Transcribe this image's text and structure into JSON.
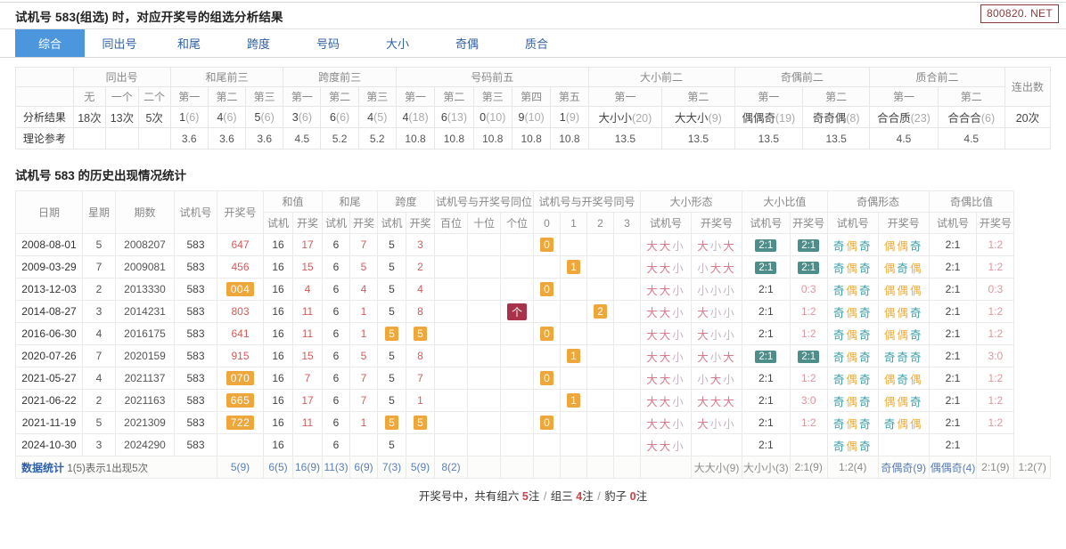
{
  "header": {
    "title": "试机号 583(组选) 时，对应开奖号的组选分析结果",
    "site_badge": "800820. NET"
  },
  "tabs": [
    {
      "label": "综合",
      "active": true
    },
    {
      "label": "同出号",
      "active": false
    },
    {
      "label": "和尾",
      "active": false
    },
    {
      "label": "跨度",
      "active": false
    },
    {
      "label": "号码",
      "active": false
    },
    {
      "label": "大小",
      "active": false
    },
    {
      "label": "奇偶",
      "active": false
    },
    {
      "label": "质合",
      "active": false
    }
  ],
  "analysis": {
    "group_headers": [
      {
        "label": "",
        "span": 1
      },
      {
        "label": "同出号",
        "span": 3
      },
      {
        "label": "和尾前三",
        "span": 3
      },
      {
        "label": "跨度前三",
        "span": 3
      },
      {
        "label": "号码前五",
        "span": 5
      },
      {
        "label": "大小前二",
        "span": 2
      },
      {
        "label": "奇偶前二",
        "span": 2
      },
      {
        "label": "质合前二",
        "span": 2
      },
      {
        "label": "连出数",
        "span": 1,
        "rowspan": 2
      }
    ],
    "sub_headers": [
      "无",
      "一个",
      "二个",
      "第一",
      "第二",
      "第三",
      "第一",
      "第二",
      "第三",
      "第一",
      "第二",
      "第三",
      "第四",
      "第五",
      "第一",
      "第二",
      "第一",
      "第二",
      "第一",
      "第二"
    ],
    "row_label_result": "分析结果",
    "row_label_theory": "理论参考",
    "results": [
      {
        "main": "18次",
        "paren": ""
      },
      {
        "main": "13次",
        "paren": ""
      },
      {
        "main": "5次",
        "paren": ""
      },
      {
        "main": "1",
        "paren": "(6)"
      },
      {
        "main": "4",
        "paren": "(6)"
      },
      {
        "main": "5",
        "paren": "(6)"
      },
      {
        "main": "3",
        "paren": "(6)"
      },
      {
        "main": "6",
        "paren": "(6)"
      },
      {
        "main": "4",
        "paren": "(5)"
      },
      {
        "main": "4",
        "paren": "(18)"
      },
      {
        "main": "6",
        "paren": "(13)"
      },
      {
        "main": "0",
        "paren": "(10)"
      },
      {
        "main": "9",
        "paren": "(10)"
      },
      {
        "main": "1",
        "paren": "(9)"
      },
      {
        "main": "大小小",
        "paren": "(20)"
      },
      {
        "main": "大大小",
        "paren": "(9)"
      },
      {
        "main": "偶偶奇",
        "paren": "(19)"
      },
      {
        "main": "奇奇偶",
        "paren": "(8)"
      },
      {
        "main": "合合质",
        "paren": "(23)"
      },
      {
        "main": "合合合",
        "paren": "(6)"
      }
    ],
    "lianchushu": "20次",
    "theory": [
      "",
      "",
      "",
      "3.6",
      "3.6",
      "3.6",
      "4.5",
      "5.2",
      "5.2",
      "10.8",
      "10.8",
      "10.8",
      "10.8",
      "10.8",
      "13.5",
      "13.5",
      "13.5",
      "13.5",
      "4.5",
      "4.5"
    ]
  },
  "history_section": {
    "heading": "试机号 583 的历史出现情况统计",
    "columns": {
      "date": "日期",
      "week": "星期",
      "issue": "期数",
      "shijihao": "试机号",
      "kaijianghao": "开奖号",
      "hezhi": "和值",
      "hewei": "和尾",
      "kuadu": "跨度",
      "tongwei": "试机号与开奖号同位",
      "tonghao": "试机号与开奖号同号",
      "daxiao_xingtai": "大小形态",
      "daxiao_bizhi": "大小比值",
      "jiou_xingtai": "奇偶形态",
      "jiou_bizhi": "奇偶比值",
      "sub_shiji": "试机",
      "sub_kaijiang": "开奖",
      "sub_baiwei": "百位",
      "sub_shiwei": "十位",
      "sub_gewei": "个位",
      "sub_0": "0",
      "sub_1": "1",
      "sub_2": "2",
      "sub_3": "3",
      "sub_shijihao": "试机号",
      "sub_kaijianghao": "开奖号"
    },
    "rows": [
      {
        "date": "2008-08-01",
        "week": "5",
        "issue": "2008207",
        "shijihao": "583",
        "kaijianghao": "647",
        "kj_hl": false,
        "hezhi_shiji": "16",
        "hezhi_kaijiang": "17",
        "hewei_shiji": "6",
        "hewei_kaijiang": "7",
        "kuadu_shiji": "5",
        "kuadu_shiji_hl": false,
        "kuadu_kaijiang": "3",
        "kuadu_kaijiang_hl": false,
        "tongwei": {
          "baiwei": "",
          "shiwei": "",
          "gewei": ""
        },
        "tonghao": {
          "v0": "0",
          "v1": "",
          "v2": "",
          "v3": ""
        },
        "dx_shiji": "大大小",
        "dx_kaijiang": "大小大",
        "dxb_shiji": "2:1",
        "dxb_shiji_hl": true,
        "dxb_kaijiang": "2:1",
        "dxb_kaijiang_hl": true,
        "jo_shiji": "奇偶奇",
        "jo_kaijiang": "偶偶奇",
        "job_shiji": "2:1",
        "job_kaijiang": "1:2"
      },
      {
        "date": "2009-03-29",
        "week": "7",
        "issue": "2009081",
        "shijihao": "583",
        "kaijianghao": "456",
        "kj_hl": false,
        "hezhi_shiji": "16",
        "hezhi_kaijiang": "15",
        "hewei_shiji": "6",
        "hewei_kaijiang": "5",
        "kuadu_shiji": "5",
        "kuadu_shiji_hl": false,
        "kuadu_kaijiang": "2",
        "kuadu_kaijiang_hl": false,
        "tongwei": {
          "baiwei": "",
          "shiwei": "",
          "gewei": ""
        },
        "tonghao": {
          "v0": "",
          "v1": "1",
          "v2": "",
          "v3": ""
        },
        "dx_shiji": "大大小",
        "dx_kaijiang": "小大大",
        "dxb_shiji": "2:1",
        "dxb_shiji_hl": true,
        "dxb_kaijiang": "2:1",
        "dxb_kaijiang_hl": true,
        "jo_shiji": "奇偶奇",
        "jo_kaijiang": "偶奇偶",
        "job_shiji": "2:1",
        "job_kaijiang": "1:2"
      },
      {
        "date": "2013-12-03",
        "week": "2",
        "issue": "2013330",
        "shijihao": "583",
        "kaijianghao": "004",
        "kj_hl": true,
        "hezhi_shiji": "16",
        "hezhi_kaijiang": "4",
        "hewei_shiji": "6",
        "hewei_kaijiang": "4",
        "kuadu_shiji": "5",
        "kuadu_shiji_hl": false,
        "kuadu_kaijiang": "4",
        "kuadu_kaijiang_hl": false,
        "tongwei": {
          "baiwei": "",
          "shiwei": "",
          "gewei": ""
        },
        "tonghao": {
          "v0": "0",
          "v1": "",
          "v2": "",
          "v3": ""
        },
        "dx_shiji": "大大小",
        "dx_kaijiang": "小小小",
        "dxb_shiji": "2:1",
        "dxb_shiji_hl": false,
        "dxb_kaijiang": "0:3",
        "dxb_kaijiang_hl": false,
        "jo_shiji": "奇偶奇",
        "jo_kaijiang": "偶偶偶",
        "job_shiji": "2:1",
        "job_kaijiang": "0:3"
      },
      {
        "date": "2014-08-27",
        "week": "3",
        "issue": "2014231",
        "shijihao": "583",
        "kaijianghao": "803",
        "kj_hl": false,
        "hezhi_shiji": "16",
        "hezhi_kaijiang": "11",
        "hewei_shiji": "6",
        "hewei_kaijiang": "1",
        "kuadu_shiji": "5",
        "kuadu_shiji_hl": false,
        "kuadu_kaijiang": "8",
        "kuadu_kaijiang_hl": false,
        "tongwei": {
          "baiwei": "",
          "shiwei": "",
          "gewei": "个"
        },
        "tonghao": {
          "v0": "",
          "v1": "",
          "v2": "2",
          "v3": ""
        },
        "dx_shiji": "大大小",
        "dx_kaijiang": "大小小",
        "dxb_shiji": "2:1",
        "dxb_shiji_hl": false,
        "dxb_kaijiang": "1:2",
        "dxb_kaijiang_hl": false,
        "jo_shiji": "奇偶奇",
        "jo_kaijiang": "偶偶奇",
        "job_shiji": "2:1",
        "job_kaijiang": "1:2"
      },
      {
        "date": "2016-06-30",
        "week": "4",
        "issue": "2016175",
        "shijihao": "583",
        "kaijianghao": "641",
        "kj_hl": false,
        "hezhi_shiji": "16",
        "hezhi_kaijiang": "11",
        "hewei_shiji": "6",
        "hewei_kaijiang": "1",
        "kuadu_shiji": "5",
        "kuadu_shiji_hl": true,
        "kuadu_kaijiang": "5",
        "kuadu_kaijiang_hl": true,
        "tongwei": {
          "baiwei": "",
          "shiwei": "",
          "gewei": ""
        },
        "tonghao": {
          "v0": "0",
          "v1": "",
          "v2": "",
          "v3": ""
        },
        "dx_shiji": "大大小",
        "dx_kaijiang": "大小小",
        "dxb_shiji": "2:1",
        "dxb_shiji_hl": false,
        "dxb_kaijiang": "1:2",
        "dxb_kaijiang_hl": false,
        "jo_shiji": "奇偶奇",
        "jo_kaijiang": "偶偶奇",
        "job_shiji": "2:1",
        "job_kaijiang": "1:2"
      },
      {
        "date": "2020-07-26",
        "week": "7",
        "issue": "2020159",
        "shijihao": "583",
        "kaijianghao": "915",
        "kj_hl": false,
        "hezhi_shiji": "16",
        "hezhi_kaijiang": "15",
        "hewei_shiji": "6",
        "hewei_kaijiang": "5",
        "kuadu_shiji": "5",
        "kuadu_shiji_hl": false,
        "kuadu_kaijiang": "8",
        "kuadu_kaijiang_hl": false,
        "tongwei": {
          "baiwei": "",
          "shiwei": "",
          "gewei": ""
        },
        "tonghao": {
          "v0": "",
          "v1": "1",
          "v2": "",
          "v3": ""
        },
        "dx_shiji": "大大小",
        "dx_kaijiang": "大小大",
        "dxb_shiji": "2:1",
        "dxb_shiji_hl": true,
        "dxb_kaijiang": "2:1",
        "dxb_kaijiang_hl": true,
        "jo_shiji": "奇偶奇",
        "jo_kaijiang": "奇奇奇",
        "job_shiji": "2:1",
        "job_kaijiang": "3:0"
      },
      {
        "date": "2021-05-27",
        "week": "4",
        "issue": "2021137",
        "shijihao": "583",
        "kaijianghao": "070",
        "kj_hl": true,
        "hezhi_shiji": "16",
        "hezhi_kaijiang": "7",
        "hewei_shiji": "6",
        "hewei_kaijiang": "7",
        "kuadu_shiji": "5",
        "kuadu_shiji_hl": false,
        "kuadu_kaijiang": "7",
        "kuadu_kaijiang_hl": false,
        "tongwei": {
          "baiwei": "",
          "shiwei": "",
          "gewei": ""
        },
        "tonghao": {
          "v0": "0",
          "v1": "",
          "v2": "",
          "v3": ""
        },
        "dx_shiji": "大大小",
        "dx_kaijiang": "小大小",
        "dxb_shiji": "2:1",
        "dxb_shiji_hl": false,
        "dxb_kaijiang": "1:2",
        "dxb_kaijiang_hl": false,
        "jo_shiji": "奇偶奇",
        "jo_kaijiang": "偶奇偶",
        "job_shiji": "2:1",
        "job_kaijiang": "1:2"
      },
      {
        "date": "2021-06-22",
        "week": "2",
        "issue": "2021163",
        "shijihao": "583",
        "kaijianghao": "665",
        "kj_hl": true,
        "hezhi_shiji": "16",
        "hezhi_kaijiang": "17",
        "hewei_shiji": "6",
        "hewei_kaijiang": "7",
        "kuadu_shiji": "5",
        "kuadu_shiji_hl": false,
        "kuadu_kaijiang": "1",
        "kuadu_kaijiang_hl": false,
        "tongwei": {
          "baiwei": "",
          "shiwei": "",
          "gewei": ""
        },
        "tonghao": {
          "v0": "",
          "v1": "1",
          "v2": "",
          "v3": ""
        },
        "dx_shiji": "大大小",
        "dx_kaijiang": "大大大",
        "dxb_shiji": "2:1",
        "dxb_shiji_hl": false,
        "dxb_kaijiang": "3:0",
        "dxb_kaijiang_hl": false,
        "jo_shiji": "奇偶奇",
        "jo_kaijiang": "偶偶奇",
        "job_shiji": "2:1",
        "job_kaijiang": "1:2"
      },
      {
        "date": "2021-11-19",
        "week": "5",
        "issue": "2021309",
        "shijihao": "583",
        "kaijianghao": "722",
        "kj_hl": true,
        "hezhi_shiji": "16",
        "hezhi_kaijiang": "11",
        "hewei_shiji": "6",
        "hewei_kaijiang": "1",
        "kuadu_shiji": "5",
        "kuadu_shiji_hl": true,
        "kuadu_kaijiang": "5",
        "kuadu_kaijiang_hl": true,
        "tongwei": {
          "baiwei": "",
          "shiwei": "",
          "gewei": ""
        },
        "tonghao": {
          "v0": "0",
          "v1": "",
          "v2": "",
          "v3": ""
        },
        "dx_shiji": "大大小",
        "dx_kaijiang": "大小小",
        "dxb_shiji": "2:1",
        "dxb_shiji_hl": false,
        "dxb_kaijiang": "1:2",
        "dxb_kaijiang_hl": false,
        "jo_shiji": "奇偶奇",
        "jo_kaijiang": "奇偶偶",
        "job_shiji": "2:1",
        "job_kaijiang": "1:2"
      },
      {
        "date": "2024-10-30",
        "week": "3",
        "issue": "2024290",
        "shijihao": "583",
        "kaijianghao": "",
        "kj_hl": false,
        "hezhi_shiji": "16",
        "hezhi_kaijiang": "",
        "hewei_shiji": "6",
        "hewei_kaijiang": "",
        "kuadu_shiji": "5",
        "kuadu_shiji_hl": false,
        "kuadu_kaijiang": "",
        "kuadu_kaijiang_hl": false,
        "tongwei": {
          "baiwei": "",
          "shiwei": "",
          "gewei": ""
        },
        "tonghao": {
          "v0": "",
          "v1": "",
          "v2": "",
          "v3": ""
        },
        "dx_shiji": "大大小",
        "dx_kaijiang": "",
        "dxb_shiji": "2:1",
        "dxb_shiji_hl": false,
        "dxb_kaijiang": "",
        "dxb_kaijiang_hl": false,
        "jo_shiji": "奇偶奇",
        "jo_kaijiang": "",
        "job_shiji": "2:1",
        "job_kaijiang": ""
      }
    ],
    "stats": {
      "label": "数据统计",
      "label_note": "1(5)表示1出现5次",
      "shijihao": "5(9)",
      "kaijianghao": "6(5)",
      "hezhi_shiji": "16(9)",
      "hezhi_kaijiang": "11(3)",
      "hewei_shiji": "6(9)",
      "hewei_kaijiang": "7(3)",
      "kuadu_shiji": "5(9)",
      "kuadu_kaijiang": "8(2)",
      "tongwei_baiwei": "",
      "tongwei_shiwei": "",
      "tongwei_gewei": "",
      "tonghao_0": "",
      "tonghao_1": "",
      "tonghao_2": "",
      "tonghao_3": "",
      "dx_shiji": "大大小(9)",
      "dx_kaijiang": "大小小(3)",
      "dxb_shiji": "2:1(9)",
      "dxb_kaijiang": "1:2(4)",
      "jo_shiji": "奇偶奇(9)",
      "jo_kaijiang": "偶偶奇(4)",
      "job_shiji": "2:1(9)",
      "job_kaijiang": "1:2(7)"
    }
  },
  "bottom_note": {
    "prefix": "开奖号中，共有组六 ",
    "zuliu": "5",
    "mid1": "注 ",
    "sep1": "/",
    "zusan_label": " 组三 ",
    "zusan": "4",
    "mid2": "注 ",
    "sep2": "/",
    "baozi_label": " 豹子 ",
    "baozi": "0",
    "suffix": "注"
  },
  "colors": {
    "accent_blue": "#4b96dd",
    "orange_hl": "#efa73b",
    "red_hl": "#a8324a",
    "teal_hl": "#4e8e8a",
    "red_text": "#d05c5c",
    "badge_border": "#8a3a3a"
  }
}
